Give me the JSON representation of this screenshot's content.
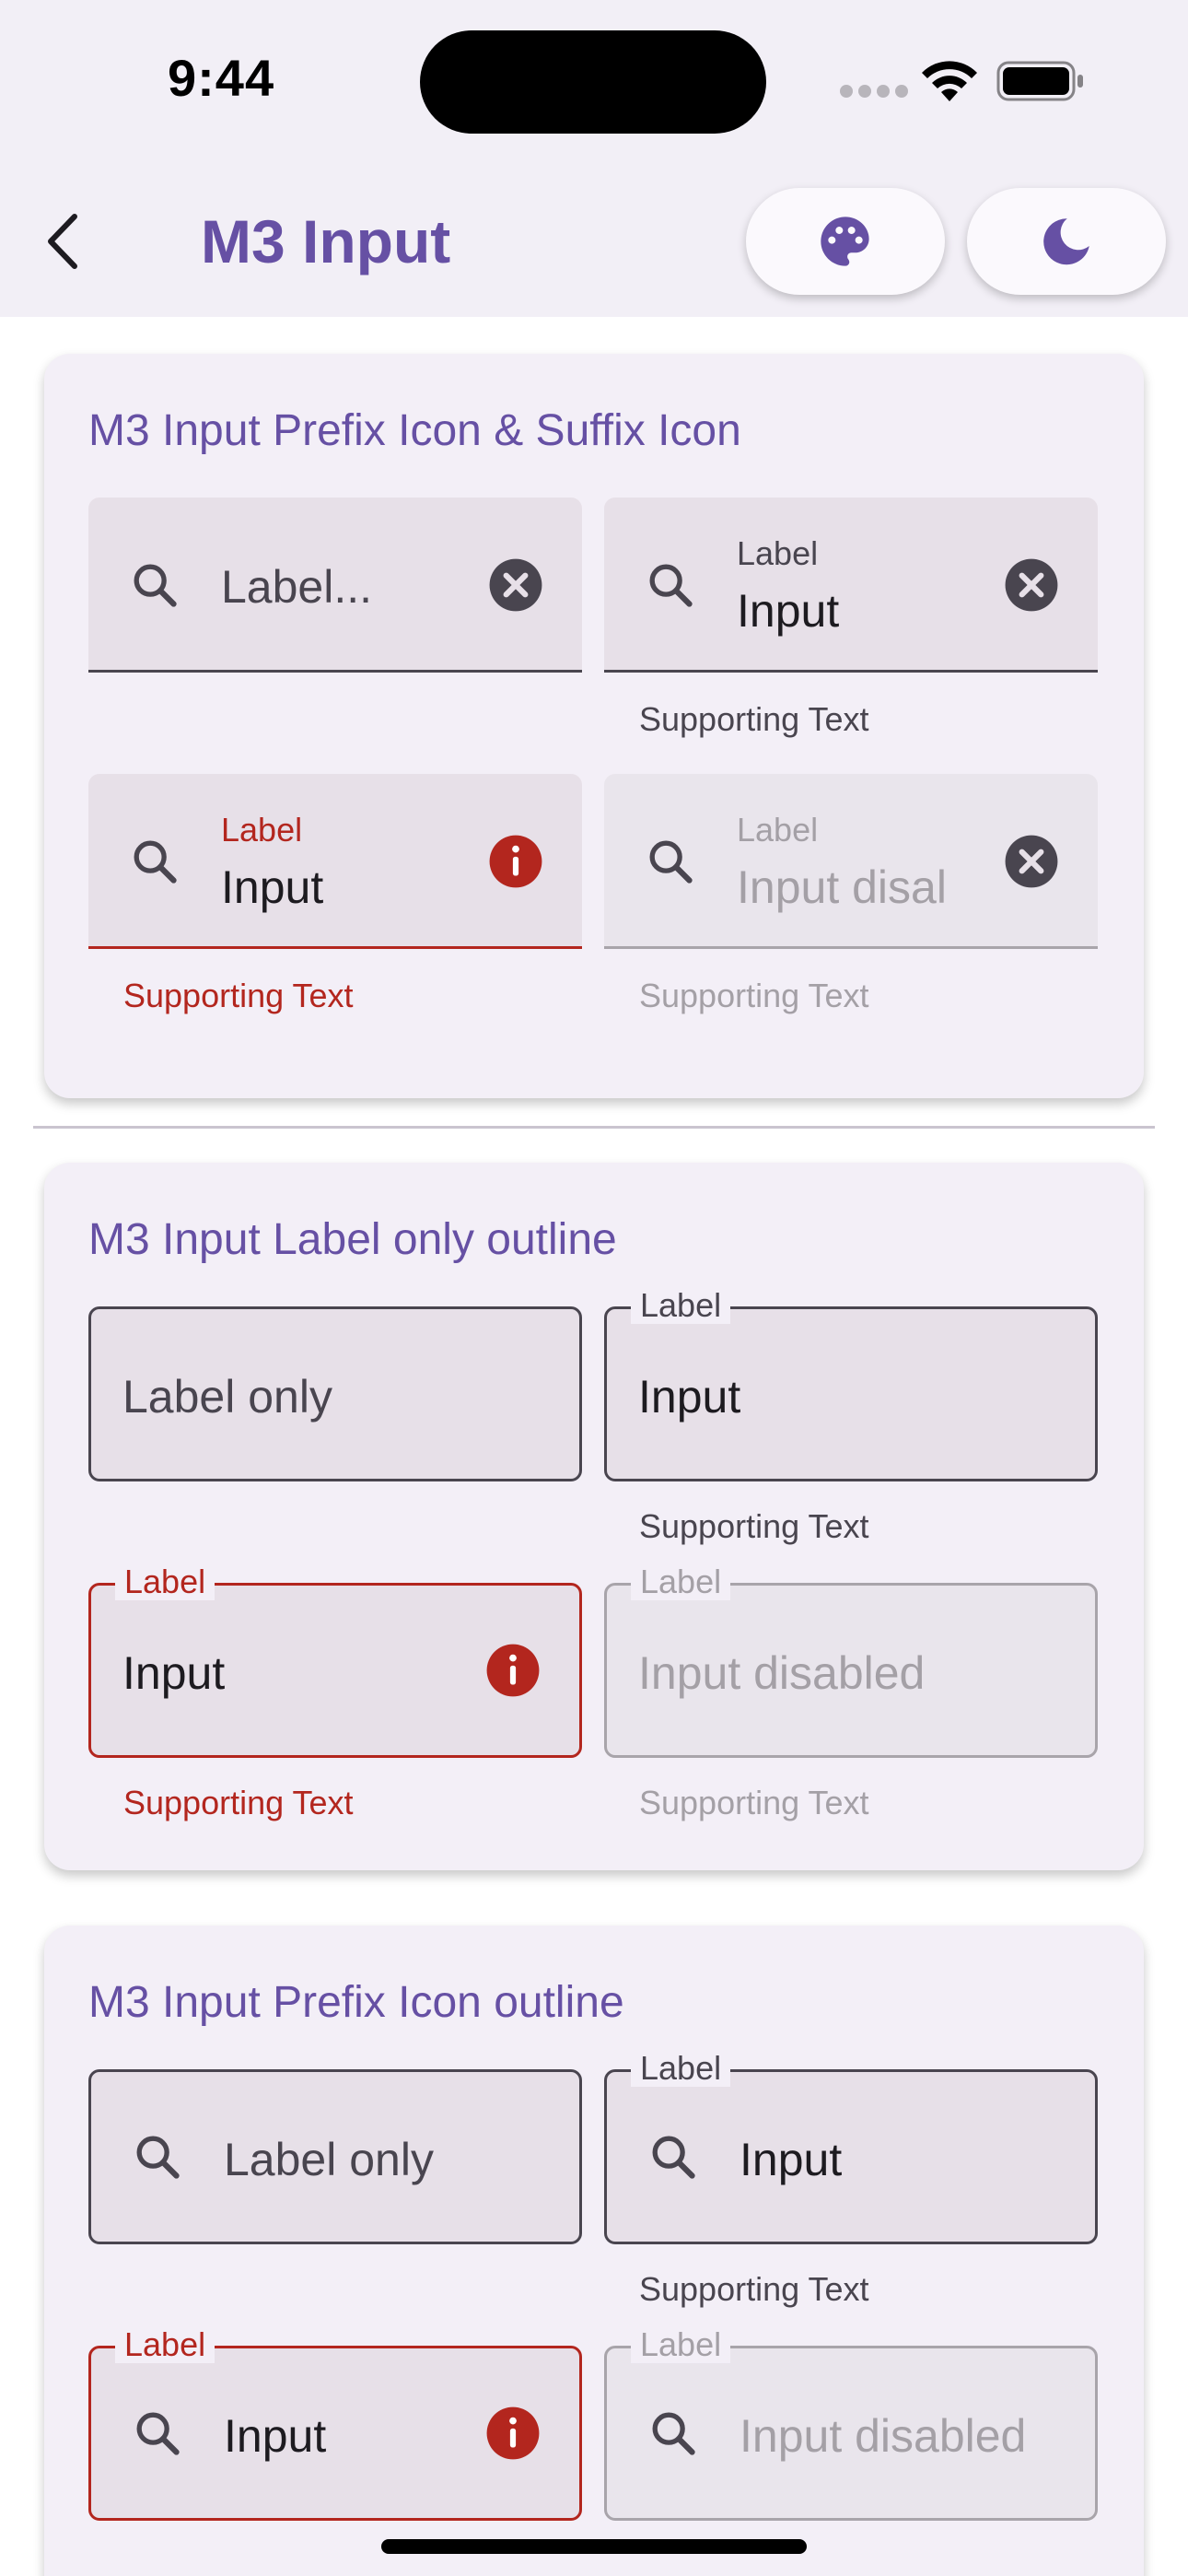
{
  "status_bar": {
    "time": "9:44"
  },
  "app_bar": {
    "title": "M3 Input",
    "back_icon": "chevron-left-icon",
    "actions": [
      {
        "icon": "palette-icon"
      },
      {
        "icon": "moon-icon"
      }
    ],
    "accent_color": "#6650a4"
  },
  "sections": [
    {
      "title": "M3 Input Prefix Icon & Suffix Icon",
      "fields": [
        {
          "variant": "filled",
          "state": "placeholder",
          "placeholder": "Label...",
          "leading_icon": "search-icon",
          "trailing_icon": "clear-icon"
        },
        {
          "variant": "filled",
          "state": "filled",
          "label": "Label",
          "value": "Input",
          "supporting_text": "Supporting Text",
          "leading_icon": "search-icon",
          "trailing_icon": "clear-icon"
        },
        {
          "variant": "filled",
          "state": "error",
          "label": "Label",
          "value": "Input",
          "supporting_text": "Supporting Text",
          "leading_icon": "search-icon",
          "trailing_icon": "error-info-icon"
        },
        {
          "variant": "filled",
          "state": "disabled",
          "label": "Label",
          "value": "Input disal",
          "supporting_text": "Supporting Text",
          "leading_icon": "search-icon",
          "trailing_icon": "clear-icon"
        }
      ]
    },
    {
      "title": "M3 Input Label only outline",
      "fields": [
        {
          "variant": "outlined",
          "state": "placeholder",
          "placeholder": "Label only"
        },
        {
          "variant": "outlined",
          "state": "filled",
          "label": "Label",
          "value": "Input",
          "supporting_text": "Supporting Text"
        },
        {
          "variant": "outlined",
          "state": "error",
          "label": "Label",
          "value": "Input",
          "supporting_text": "Supporting Text",
          "trailing_icon": "error-info-icon"
        },
        {
          "variant": "outlined",
          "state": "disabled",
          "label": "Label",
          "value": "Input disabled",
          "supporting_text": "Supporting Text"
        }
      ]
    },
    {
      "title": "M3 Input Prefix Icon outline",
      "fields": [
        {
          "variant": "outlined",
          "state": "placeholder",
          "placeholder": "Label only",
          "leading_icon": "search-icon"
        },
        {
          "variant": "outlined",
          "state": "filled",
          "label": "Label",
          "value": "Input",
          "supporting_text": "Supporting Text",
          "leading_icon": "search-icon"
        },
        {
          "variant": "outlined",
          "state": "error",
          "label": "Label",
          "value": "Input",
          "leading_icon": "search-icon",
          "trailing_icon": "error-info-icon"
        },
        {
          "variant": "outlined",
          "state": "disabled",
          "label": "Label",
          "value": "Input disabled",
          "leading_icon": "search-icon"
        }
      ]
    }
  ],
  "colors": {
    "error": "#b3261e",
    "surface": "#f3eff7",
    "field_fill": "#e7e0e8",
    "outline": "#49454f"
  }
}
